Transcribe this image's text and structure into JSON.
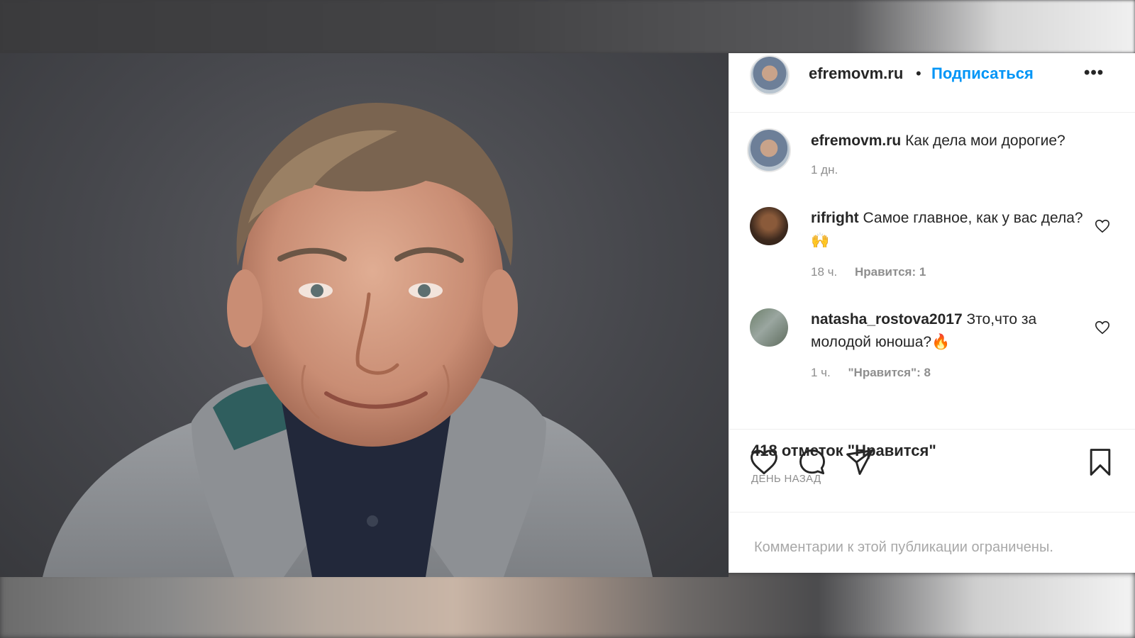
{
  "post": {
    "author": "efremovm.ru",
    "separator": "•",
    "follow_label": "Подписаться",
    "more_label": "•••",
    "caption": {
      "username": "efremovm.ru",
      "text": "Как дела мои дорогие?",
      "time": "1 дн."
    },
    "comments": [
      {
        "username": "rifright",
        "text": "Самое главное, как у вас дела?🙌",
        "time": "18 ч.",
        "likes": "Нравится: 1"
      },
      {
        "username": "natasha_rostova2017",
        "text": "Зто,что за молодой юноша?🔥",
        "time": "1 ч.",
        "likes": "\"Нравится\": 8"
      }
    ],
    "likes_count": "418 отметок \"Нравится\"",
    "time_ago": "ДЕНЬ НАЗАД",
    "comments_restricted": "Комментарии к этой публикации ограничены."
  },
  "icons": {
    "like": "heart-icon",
    "comment": "comment-bubble-icon",
    "share": "paper-plane-icon",
    "save": "bookmark-icon",
    "comment_like": "small-heart-icon"
  },
  "colors": {
    "link": "#0095f6",
    "text": "#262626",
    "muted": "#8e8e8e"
  }
}
